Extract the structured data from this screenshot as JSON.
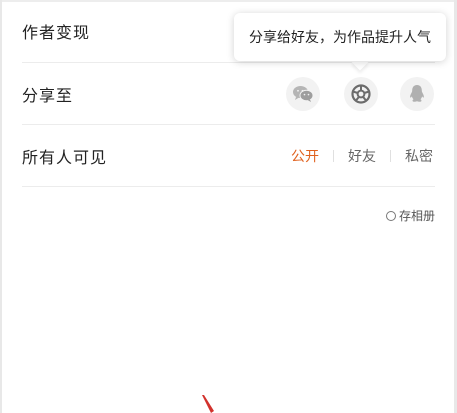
{
  "rows": {
    "monetize_label": "作者变现",
    "share_label": "分享至",
    "visibility_label": "所有人可见"
  },
  "tooltip": {
    "text": "分享给好友，为作品提升人气"
  },
  "share_targets": [
    {
      "icon": "wechat-icon"
    },
    {
      "icon": "moments-icon"
    },
    {
      "icon": "qq-icon"
    }
  ],
  "visibility": {
    "options": [
      "公开",
      "好友",
      "私密"
    ],
    "selected": "公开"
  },
  "save_album": {
    "label": "存相册",
    "checked": false
  },
  "colors": {
    "accent": "#e0621f",
    "annotation_arrow": "#d2322d"
  }
}
